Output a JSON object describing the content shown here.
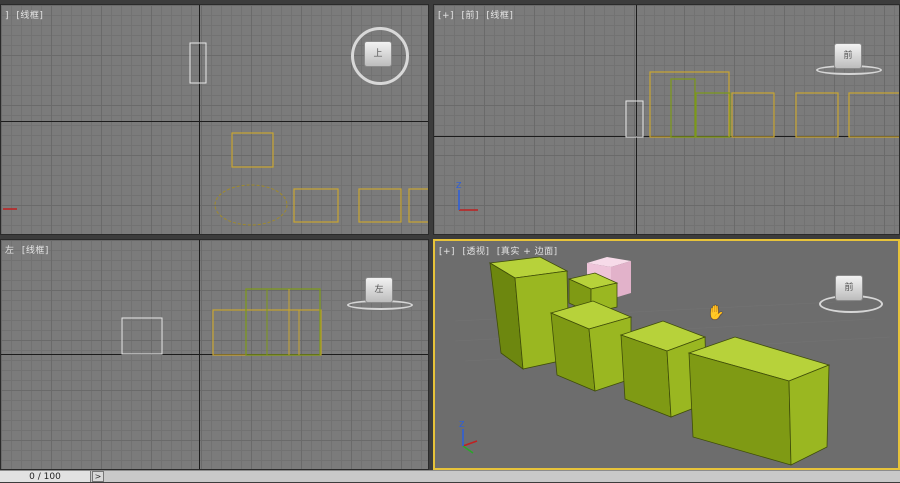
{
  "viewports": {
    "top": {
      "label_parts": [
        "]",
        "[线框]"
      ],
      "viewcube_label": "上"
    },
    "front": {
      "label_parts": [
        "[+]",
        "[前]",
        "[线框]"
      ],
      "viewcube_label": "前"
    },
    "left": {
      "label_parts": [
        "左",
        "[线框]"
      ],
      "viewcube_label": "左"
    },
    "perspective": {
      "label_parts": [
        "[+]",
        "[透视]",
        "[真实 + 边面]"
      ],
      "viewcube_label": "前"
    }
  },
  "axis_labels": {
    "z": "Z"
  },
  "timeline": {
    "frame_counter": "0 / 100",
    "next_button": ">"
  },
  "colors": {
    "active_viewport_border": "#e7c33a",
    "box_green": "#9ab721",
    "box_pink": "#f0c8dc",
    "wire_green": "#7c9a18",
    "wire_yellow": "#c9a630"
  }
}
